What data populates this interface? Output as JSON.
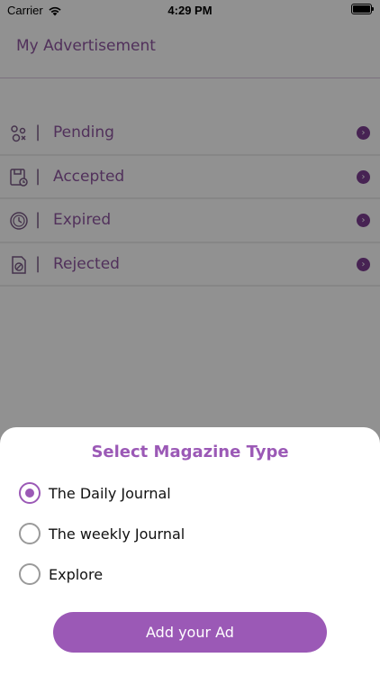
{
  "status_bar": {
    "carrier": "Carrier",
    "time": "4:29 PM"
  },
  "header": {
    "title": "My Advertisement"
  },
  "menu": {
    "separator": "|",
    "items": [
      {
        "label": "Pending",
        "icon": "pending-icon"
      },
      {
        "label": "Accepted",
        "icon": "accepted-icon"
      },
      {
        "label": "Expired",
        "icon": "expired-icon"
      },
      {
        "label": "Rejected",
        "icon": "rejected-icon"
      }
    ]
  },
  "sheet": {
    "title": "Select Magazine Type",
    "options": [
      {
        "label": "The Daily Journal",
        "selected": true
      },
      {
        "label": "The weekly Journal",
        "selected": false
      },
      {
        "label": "Explore",
        "selected": false
      }
    ],
    "button_label": "Add your Ad"
  },
  "colors": {
    "accent": "#9b59b6",
    "arrow": "#7d3f93",
    "overlay": "rgba(0,0,0,0.43)"
  }
}
